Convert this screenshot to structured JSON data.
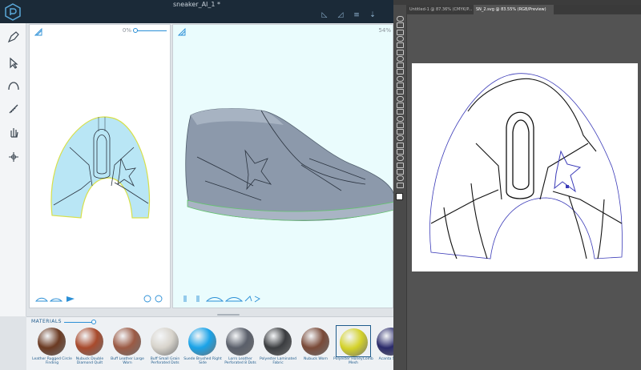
{
  "app": {
    "title": "sneaker_AI_1 *",
    "logo": "app-logo",
    "title_actions": [
      "flatten-pattern-icon",
      "edit-pattern-icon",
      "more-options-icon",
      "sync-icon"
    ]
  },
  "toolbar": {
    "tools": [
      "pen-icon",
      "select-icon",
      "curve-icon",
      "measure-icon",
      "hand-icon",
      "center-icon"
    ],
    "active": "select-icon"
  },
  "panel2d": {
    "zoom": "0%",
    "zoom_value": 0,
    "fill_color": "#b9e6f5",
    "stroke_color": "#d7e04a",
    "bottom_left_icons": [
      "view-top-icon",
      "view-side-icon",
      "view-arrow-icon"
    ],
    "bottom_right_icons": [
      "rotate-left-icon",
      "rotate-right-icon"
    ]
  },
  "panel3d": {
    "zoom": "54%",
    "bottom_icons": [
      "view-front-icon",
      "view-back-icon",
      "view-side-left-icon",
      "view-side-right-icon",
      "view-heel-icon",
      "view-top-icon"
    ]
  },
  "materials": {
    "label": "MATERIALS",
    "items": [
      {
        "name": "Leather Rugged Circle Finding",
        "color": "#6b3a22"
      },
      {
        "name": "Nubuck Double Diamond Quilt",
        "color": "#a84a2c"
      },
      {
        "name": "Buff Leather Large Worn",
        "color": "#9b5a44"
      },
      {
        "name": "Buff Small Grain Perforated Dots",
        "color": "#d8d4cc"
      },
      {
        "name": "Suede Brushed Right Side",
        "color": "#1aa3e8"
      },
      {
        "name": "Lorrs Leather Perforated 8 Dots",
        "color": "#5a5f6a"
      },
      {
        "name": "Polyester Laminated Fabric",
        "color": "#3b3d40"
      },
      {
        "name": "Nubuck Worn",
        "color": "#7a4a38"
      },
      {
        "name": "Polyester HoneyComb Mesh",
        "color": "#d4d22a"
      },
      {
        "name": "Acanta Snake",
        "color": "#2a2a6a"
      }
    ],
    "selected": "Polyester HoneyComb Mesh"
  },
  "illustrator": {
    "tabs": [
      "Untitled-1 @ 87.36% (CMYK/P...",
      "SN_2.svg @ 83.55% (RGB/Preview)"
    ],
    "active_tab": "SN_2.svg @ 83.55% (RGB/Preview)"
  }
}
